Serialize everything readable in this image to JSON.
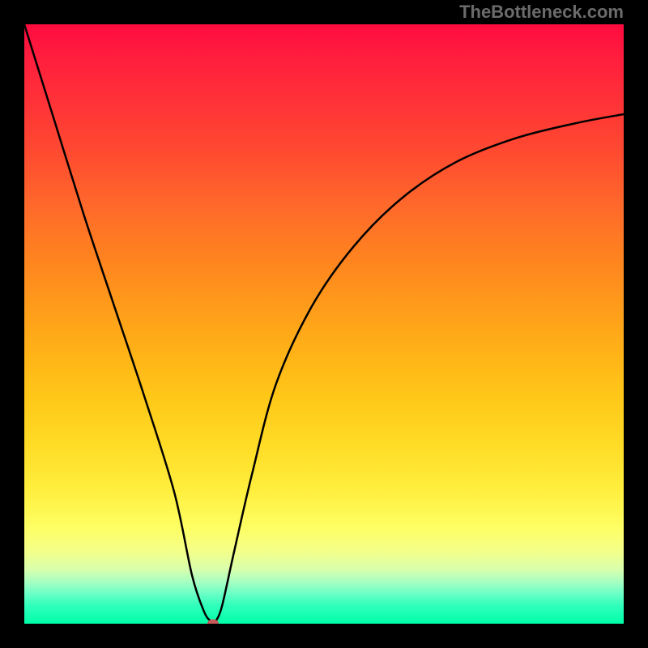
{
  "watermark": "TheBottleneck.com",
  "chart_data": {
    "type": "line",
    "title": "",
    "xlabel": "",
    "ylabel": "",
    "xlim": [
      0,
      100
    ],
    "ylim": [
      0,
      100
    ],
    "x": [
      0,
      5,
      10,
      15,
      20,
      25,
      28,
      30,
      31,
      31.5,
      32,
      33,
      35,
      38,
      42,
      48,
      55,
      63,
      72,
      82,
      92,
      100
    ],
    "values": [
      100,
      84,
      68,
      53,
      38,
      22,
      8,
      2,
      0.5,
      0,
      0.5,
      3,
      12,
      25,
      40,
      53,
      63,
      71,
      77,
      81,
      83.5,
      85
    ],
    "marker": {
      "x": 31.5,
      "y": 0
    }
  }
}
